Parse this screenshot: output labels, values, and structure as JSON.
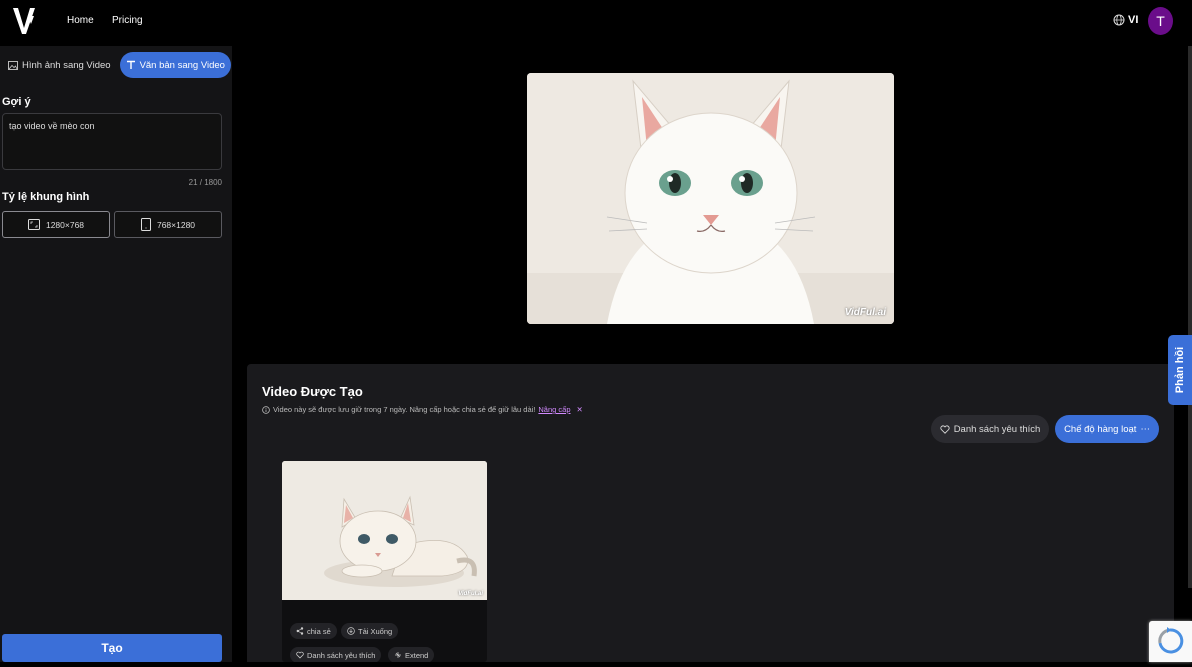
{
  "nav": {
    "home": "Home",
    "pricing": "Pricing",
    "language": "VI",
    "avatar_letter": "T"
  },
  "sidebar": {
    "tabs": [
      {
        "label": "Hình ảnh sang Video",
        "icon": "image-icon"
      },
      {
        "label": "Văn bản sang Video",
        "icon": "text-icon"
      }
    ],
    "prompt_label": "Gợi ý",
    "prompt_value": "tạo video về mèo con",
    "counter": "21 / 1800",
    "ratio_label": "Tỷ lệ khung hình",
    "ratios": [
      {
        "label": "1280×768",
        "icon": "landscape-icon"
      },
      {
        "label": "768×1280",
        "icon": "portrait-icon"
      }
    ],
    "create_label": "Tạo"
  },
  "preview": {
    "watermark": "VidFul.ai"
  },
  "generated": {
    "title": "Video Được Tạo",
    "note": "Video này sẽ được lưu giữ trong 7 ngày. Nâng cấp hoặc chia sẻ để giữ lâu dài!",
    "upgrade_link": "Nâng cấp",
    "favorites_button": "Danh sách yêu thích",
    "batch_button": "Chế độ hàng loạt",
    "card": {
      "watermark": "VidFul.ai",
      "share": "chia sẻ",
      "download": "Tải Xuống",
      "favorite": "Danh sách yêu thích",
      "extend": "Extend"
    }
  },
  "feedback": "Phản hồi",
  "colors": {
    "accent": "#3b6fd8",
    "avatar": "#6a0d8a",
    "link": "#d28aff"
  }
}
